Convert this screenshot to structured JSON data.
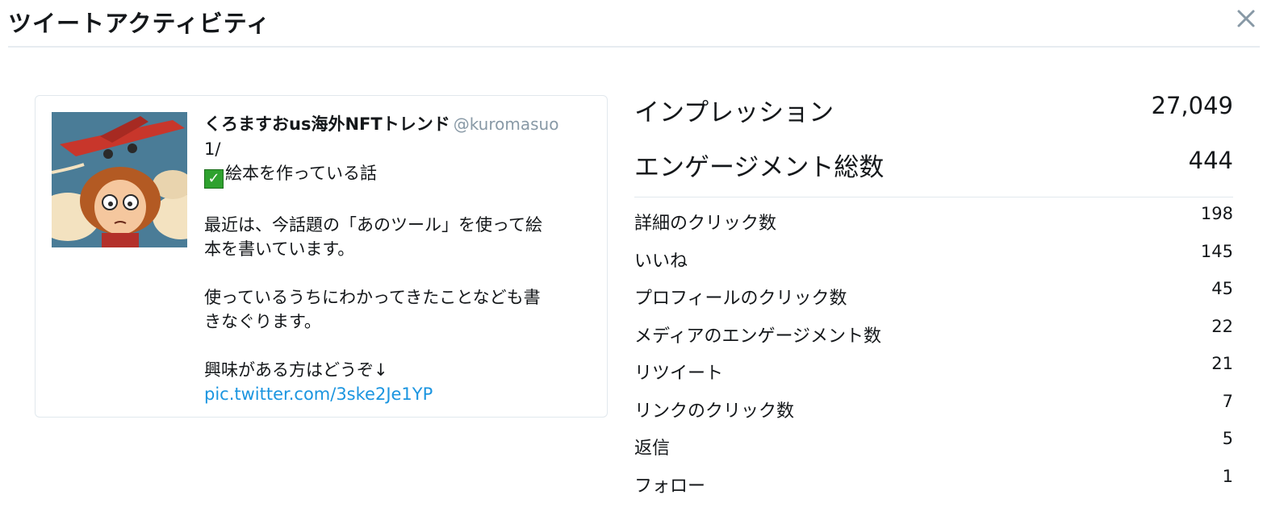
{
  "header": {
    "title": "ツイートアクティビティ",
    "close_icon": "close-icon"
  },
  "tweet": {
    "avatar_icon": "illustrated-avatar",
    "author_name": "くろますおus海外NFTトレンド",
    "author_handle": "@kuromasuo",
    "line1": "1/",
    "check_emoji": "✓",
    "line2": "絵本を作っている話",
    "paragraph1": "最近は、今話題の「あのツール」を使って絵\n本を書いています。",
    "paragraph2": "使っているうちにわかってきたことなども書\nきなぐります。",
    "paragraph3": "興味がある方はどうぞ↓",
    "link": "pic.twitter.com/3ske2Je1YP"
  },
  "stats": {
    "impressions": {
      "label": "インプレッション",
      "value": "27,049"
    },
    "engagements": {
      "label": "エンゲージメント総数",
      "value": "444"
    },
    "rows": [
      {
        "label": "詳細のクリック数",
        "value": "198"
      },
      {
        "label": "いいね",
        "value": "145"
      },
      {
        "label": "プロフィールのクリック数",
        "value": "45"
      },
      {
        "label": "メディアのエンゲージメント数",
        "value": "22"
      },
      {
        "label": "リツイート",
        "value": "21"
      },
      {
        "label": "リンクのクリック数",
        "value": "7"
      },
      {
        "label": "返信",
        "value": "5"
      },
      {
        "label": "フォロー",
        "value": "1"
      }
    ]
  },
  "colors": {
    "link": "#1b95e0",
    "handle": "#8899a6",
    "divider": "#e6ecf0",
    "text": "#14171a"
  }
}
